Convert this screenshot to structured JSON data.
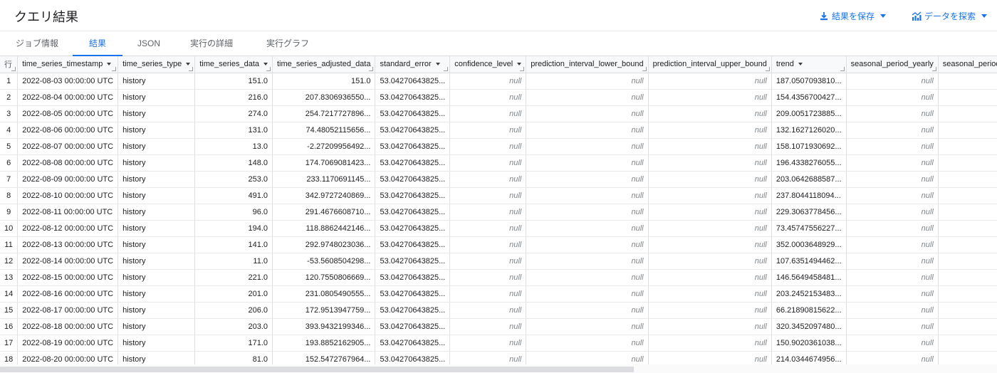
{
  "header": {
    "title": "クエリ結果",
    "save_label": "結果を保存",
    "explore_label": "データを探索"
  },
  "tabs": [
    {
      "label": "ジョブ情報",
      "active": false
    },
    {
      "label": "結果",
      "active": true
    },
    {
      "label": "JSON",
      "active": false
    },
    {
      "label": "実行の詳細",
      "active": false
    },
    {
      "label": "実行グラフ",
      "active": false
    }
  ],
  "table": {
    "row_header": "行",
    "columns": [
      {
        "label": "time_series_timestamp",
        "sortable": true
      },
      {
        "label": "time_series_type",
        "sortable": true
      },
      {
        "label": "time_series_data",
        "sortable": true
      },
      {
        "label": "time_series_adjusted_data",
        "sortable": false
      },
      {
        "label": "standard_error",
        "sortable": true
      },
      {
        "label": "confidence_level",
        "sortable": true
      },
      {
        "label": "prediction_interval_lower_bound",
        "sortable": false
      },
      {
        "label": "prediction_interval_upper_bound",
        "sortable": false
      },
      {
        "label": "trend",
        "sortable": true
      },
      {
        "label": "seasonal_period_yearly",
        "sortable": false
      },
      {
        "label": "seasonal_period_quarterly",
        "sortable": false
      }
    ],
    "null_text": "null",
    "rows": [
      [
        "1",
        "2022-08-03 00:00:00 UTC",
        "history",
        "151.0",
        "151.0",
        "53.04270643825...",
        "null",
        "null",
        "null",
        "187.0507093810...",
        "null",
        ""
      ],
      [
        "2",
        "2022-08-04 00:00:00 UTC",
        "history",
        "216.0",
        "207.8306936550...",
        "53.04270643825...",
        "null",
        "null",
        "null",
        "154.4356700427...",
        "null",
        ""
      ],
      [
        "3",
        "2022-08-05 00:00:00 UTC",
        "history",
        "274.0",
        "254.7217727896...",
        "53.04270643825...",
        "null",
        "null",
        "null",
        "209.0051723885...",
        "null",
        ""
      ],
      [
        "4",
        "2022-08-06 00:00:00 UTC",
        "history",
        "131.0",
        "74.48052115656...",
        "53.04270643825...",
        "null",
        "null",
        "null",
        "132.1627126020...",
        "null",
        ""
      ],
      [
        "5",
        "2022-08-07 00:00:00 UTC",
        "history",
        "13.0",
        "-2.27209956492...",
        "53.04270643825...",
        "null",
        "null",
        "null",
        "158.1071930692...",
        "null",
        ""
      ],
      [
        "6",
        "2022-08-08 00:00:00 UTC",
        "history",
        "148.0",
        "174.7069081423...",
        "53.04270643825...",
        "null",
        "null",
        "null",
        "196.4338276055...",
        "null",
        ""
      ],
      [
        "7",
        "2022-08-09 00:00:00 UTC",
        "history",
        "253.0",
        "233.1170691145...",
        "53.04270643825...",
        "null",
        "null",
        "null",
        "203.0642688587...",
        "null",
        ""
      ],
      [
        "8",
        "2022-08-10 00:00:00 UTC",
        "history",
        "491.0",
        "342.9727240869...",
        "53.04270643825...",
        "null",
        "null",
        "null",
        "237.8044118094...",
        "null",
        ""
      ],
      [
        "9",
        "2022-08-11 00:00:00 UTC",
        "history",
        "96.0",
        "291.4676608710...",
        "53.04270643825...",
        "null",
        "null",
        "null",
        "229.3063778456...",
        "null",
        ""
      ],
      [
        "10",
        "2022-08-12 00:00:00 UTC",
        "history",
        "194.0",
        "118.8862442146...",
        "53.04270643825...",
        "null",
        "null",
        "null",
        "73.45747556227...",
        "null",
        ""
      ],
      [
        "11",
        "2022-08-13 00:00:00 UTC",
        "history",
        "141.0",
        "292.9748023036...",
        "53.04270643825...",
        "null",
        "null",
        "null",
        "352.0003648929...",
        "null",
        ""
      ],
      [
        "12",
        "2022-08-14 00:00:00 UTC",
        "history",
        "11.0",
        "-53.5608504298...",
        "53.04270643825...",
        "null",
        "null",
        "null",
        "107.6351494462...",
        "null",
        ""
      ],
      [
        "13",
        "2022-08-15 00:00:00 UTC",
        "history",
        "221.0",
        "120.7550806669...",
        "53.04270643825...",
        "null",
        "null",
        "null",
        "146.5649458481...",
        "null",
        ""
      ],
      [
        "14",
        "2022-08-16 00:00:00 UTC",
        "history",
        "201.0",
        "231.0805490555...",
        "53.04270643825...",
        "null",
        "null",
        "null",
        "203.2452153483...",
        "null",
        ""
      ],
      [
        "15",
        "2022-08-17 00:00:00 UTC",
        "history",
        "206.0",
        "172.9513947759...",
        "53.04270643825...",
        "null",
        "null",
        "null",
        "66.21890815622...",
        "null",
        ""
      ],
      [
        "16",
        "2022-08-18 00:00:00 UTC",
        "history",
        "203.0",
        "393.9432199346...",
        "53.04270643825...",
        "null",
        "null",
        "null",
        "320.3452097480...",
        "null",
        ""
      ],
      [
        "17",
        "2022-08-19 00:00:00 UTC",
        "history",
        "171.0",
        "193.8852162905...",
        "53.04270643825...",
        "null",
        "null",
        "null",
        "150.9020361038...",
        "null",
        ""
      ],
      [
        "18",
        "2022-08-20 00:00:00 UTC",
        "history",
        "81.0",
        "152.5472767964...",
        "53.04270643825...",
        "null",
        "null",
        "null",
        "214.0344674956...",
        "null",
        ""
      ]
    ]
  },
  "colors": {
    "accent": "#1a73e8",
    "header_bg": "#f8f9fa",
    "grid_line": "#e0e0e0",
    "null_text": "#80868b"
  }
}
